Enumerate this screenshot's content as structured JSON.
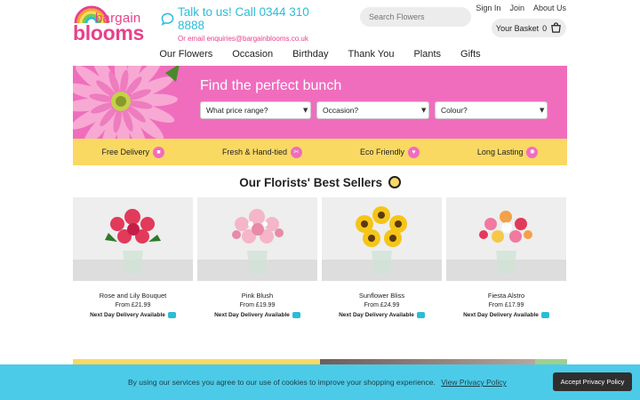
{
  "logo": {
    "line1": "bargain",
    "line2": "blooms"
  },
  "contact": {
    "phone_text": "Talk to us! Call 0344 310 8888",
    "email_text": "Or email enquiries@bargainblooms.co.uk"
  },
  "search": {
    "placeholder": "Search Flowers"
  },
  "top_links": {
    "sign_in": "Sign In",
    "join": "Join",
    "about": "About Us"
  },
  "basket": {
    "label": "Your Basket",
    "count": "0"
  },
  "nav": [
    "Our Flowers",
    "Occasion",
    "Birthday",
    "Thank You",
    "Plants",
    "Gifts"
  ],
  "hero": {
    "title": "Find the perfect bunch",
    "price_select": "What price range?",
    "occasion_select": "Occasion?",
    "colour_select": "Colour?"
  },
  "usp": [
    "Free Delivery",
    "Fresh & Hand-tied",
    "Eco Friendly",
    "Long Lasting"
  ],
  "best_sellers": {
    "title": "Our Florists' Best Sellers",
    "products": [
      {
        "name": "Rose and Lily Bouquet",
        "price": "From £21.99",
        "delivery": "Next Day Delivery Available"
      },
      {
        "name": "Pink Blush",
        "price": "From £19.99",
        "delivery": "Next Day Delivery Available"
      },
      {
        "name": "Sunflower Bliss",
        "price": "From £24.99",
        "delivery": "Next Day Delivery Available"
      },
      {
        "name": "Fiesta Alstro",
        "price": "From £17.99",
        "delivery": "Next Day Delivery Available"
      }
    ]
  },
  "cookie": {
    "message": "By using our services you agree to our use of cookies to improve your shopping experience.",
    "link": "View Privacy Policy",
    "accept": "Accept Privacy Policy"
  },
  "colors": {
    "brand_pink": "#e8418b",
    "hero_pink": "#f06dbd",
    "accent_teal": "#2bbcd8",
    "usp_yellow": "#fad963",
    "cookie_blue": "#4ccbe8"
  }
}
